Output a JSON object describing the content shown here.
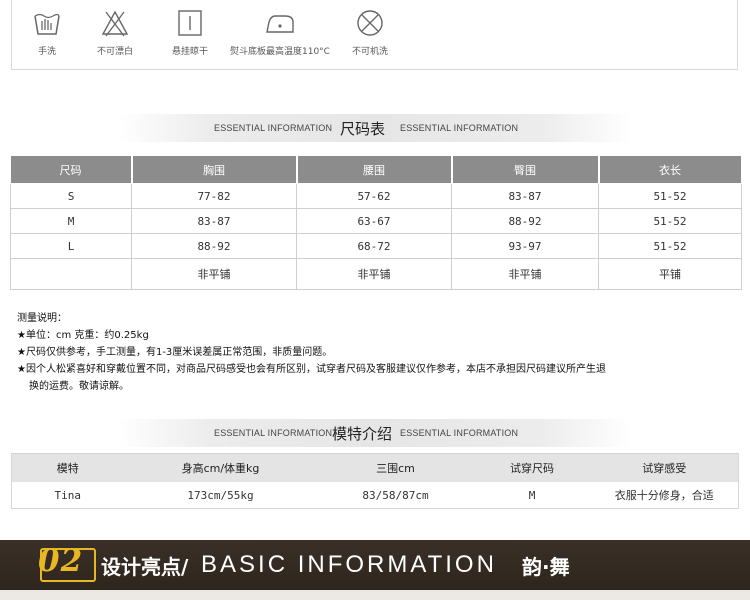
{
  "care": {
    "items": [
      {
        "icon": "hand-wash-icon",
        "label": "手洗"
      },
      {
        "icon": "no-bleach-icon",
        "label": "不可漂白"
      },
      {
        "icon": "line-dry-icon",
        "label": "悬挂晾干"
      },
      {
        "icon": "iron-110-icon",
        "label": "熨斗底板最高温度110°C"
      },
      {
        "icon": "no-machine-wash-icon",
        "label": "不可机洗"
      }
    ]
  },
  "size_section": {
    "en_left": "ESSENTIAL INFORMATION",
    "title": "尺码表",
    "en_right": "ESSENTIAL INFORMATION"
  },
  "size_table": {
    "headers": [
      "尺码",
      "胸围",
      "腰围",
      "臀围",
      "衣长"
    ],
    "rows": [
      [
        "S",
        "77-82",
        "57-62",
        "83-87",
        "51-52"
      ],
      [
        "M",
        "83-87",
        "63-67",
        "88-92",
        "51-52"
      ],
      [
        "L",
        "88-92",
        "68-72",
        "93-97",
        "51-52"
      ]
    ],
    "note_row": [
      "",
      "非平铺",
      "非平铺",
      "非平铺",
      "平铺"
    ]
  },
  "notes": {
    "title": "测量说明：",
    "lines": [
      "★单位：cm  克重：约0.25kg",
      "★尺码仅供参考，手工测量，有1-3厘米误差属正常范围，非质量问题。",
      "★因个人松紧喜好和穿戴位置不同，对商品尺码感受也会有所区别，试穿者尺码及客服建议仅作参考，本店不承担因尺码建议所产生退"
    ],
    "continuation": "换的运费。敬请谅解。"
  },
  "model_section": {
    "en_left": "ESSENTIAL INFORMATION",
    "title": "模特介绍",
    "en_right": "ESSENTIAL INFORMATION"
  },
  "model_table": {
    "headers": [
      "模特",
      "身高cm/体重kg",
      "三围cm",
      "试穿尺码",
      "试穿感受"
    ],
    "row": [
      "Tina",
      "173cm/55kg",
      "83/58/87cm",
      "M",
      "衣服十分修身，合适"
    ]
  },
  "bottom_section": {
    "number": "02",
    "title_cn": "设计亮点/",
    "title_en": "BASIC INFORMATION",
    "brand": "韵·舞"
  },
  "colors": {
    "table_header": "#8c8c8c",
    "accent_gold": "#e7b823",
    "bottom_bar": "#2e251d"
  }
}
